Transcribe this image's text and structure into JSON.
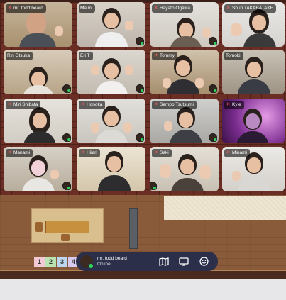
{
  "participants": [
    {
      "name": "mr. todd beard",
      "muted": true
    },
    {
      "name": "Maimi",
      "muted": false
    },
    {
      "name": "Hayato Ogawa",
      "muted": true
    },
    {
      "name": "Shun TAKABATAKE",
      "muted": true
    },
    {
      "name": "Rin Otsuka",
      "muted": false
    },
    {
      "name": "Eri T",
      "muted": false
    },
    {
      "name": "Tommy",
      "muted": true
    },
    {
      "name": "Tomoki",
      "muted": false
    },
    {
      "name": "Miri Shibata",
      "muted": true
    },
    {
      "name": "Honoka",
      "muted": true
    },
    {
      "name": "Sempo Tsutsumi",
      "muted": true
    },
    {
      "name": "Kyle",
      "muted": true
    },
    {
      "name": "Manami",
      "muted": true
    },
    {
      "name": "Hiiari",
      "muted": true
    },
    {
      "name": "Saki",
      "muted": true
    },
    {
      "name": "Minami",
      "muted": true
    }
  ],
  "room": {
    "number_tiles": [
      "1",
      "2",
      "3",
      "4"
    ]
  },
  "bottom_bar": {
    "user_name": "mr. todd beard",
    "status": "Online",
    "buttons": [
      "map-icon",
      "screen-share-icon",
      "emoji-icon"
    ]
  },
  "colors": {
    "bar_bg": "#2b2f4a",
    "online": "#2fd35a",
    "muted_icon": "#ff5b5b"
  }
}
